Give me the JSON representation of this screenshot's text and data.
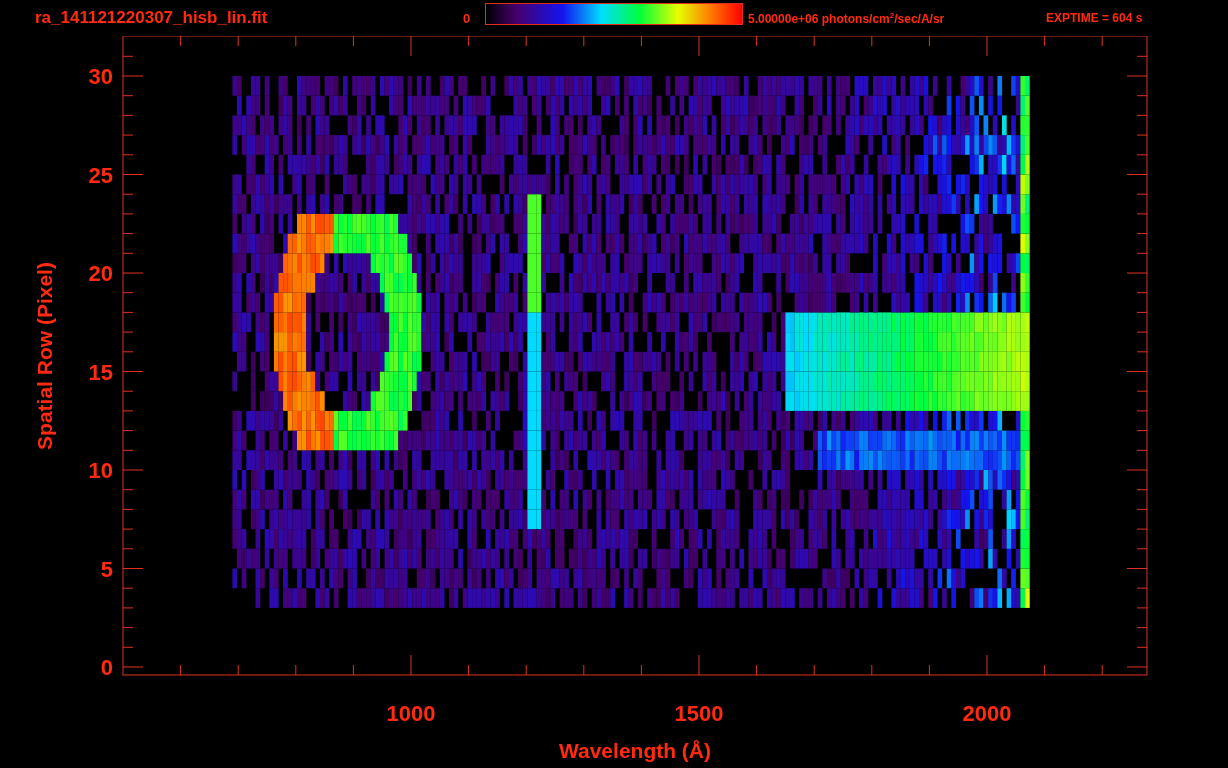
{
  "title": "ra_141121220307_hisb_lin.fit",
  "colorbar": {
    "min_label": "0",
    "max_label": "5.00000e+06 photons/cm$^{2}$/sec/A/sr"
  },
  "exposure": "EXPTIME = 604 s",
  "x_axis": {
    "label": "Wavelength (Å)",
    "ticks": [
      "1000",
      "1500",
      "2000"
    ]
  },
  "y_axis": {
    "label": "Spatial Row (Pixel)",
    "ticks": [
      "30",
      "25",
      "20",
      "15",
      "10",
      "5",
      "0"
    ]
  }
}
